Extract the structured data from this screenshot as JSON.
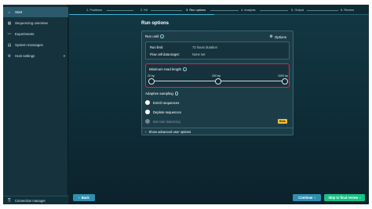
{
  "sidebar": {
    "items": [
      {
        "label": "Start",
        "icon": "home-icon",
        "active": true
      },
      {
        "label": "Sequencing overview",
        "icon": "overview-icon"
      },
      {
        "label": "Experiments",
        "icon": "chart-icon"
      },
      {
        "label": "System messages",
        "icon": "message-icon"
      },
      {
        "label": "Host settings",
        "icon": "gear-icon"
      }
    ],
    "connection": "Connection manager"
  },
  "steps": [
    "1. Positions",
    "2. Kit",
    "3. Run options",
    "4. Analysis",
    "5. Output",
    "6. Review"
  ],
  "active_step": 2,
  "page_title": "Run options",
  "run_until": {
    "label": "Run until",
    "options_label": "Options",
    "run_limit_label": "Run limit:",
    "run_limit_value": "72 hours duration",
    "flow_cell_label": "Flow cell data target:",
    "flow_cell_value": "None set"
  },
  "min_read_length": {
    "label": "Minimum read length",
    "ticks": [
      "20 bp",
      "200 bp",
      "1000 bp"
    ],
    "selected": "200 bp"
  },
  "adaptive_sampling": {
    "label": "Adaptive sampling",
    "options": [
      "Enrich sequences",
      "Deplete sequences",
      "Barcode balancing"
    ],
    "beta_label": "Beta"
  },
  "advanced_label": "Show advanced user options",
  "buttons": {
    "back": "Back",
    "continue": "Continue",
    "final": "Skip to final review"
  },
  "colors": {
    "accent": "#2f8fb0",
    "success": "#16c287",
    "highlight": "#e0244a",
    "beta": "#f3c12b"
  }
}
